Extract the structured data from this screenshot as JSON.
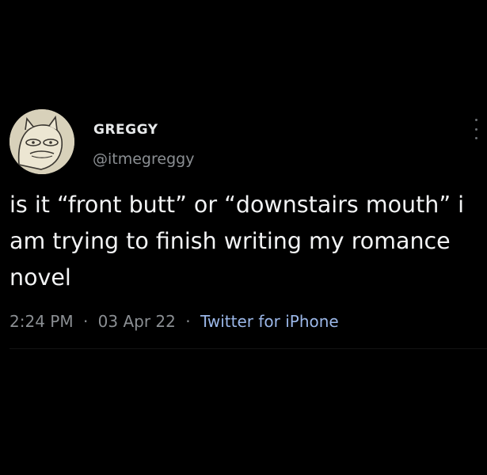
{
  "user": {
    "display_name": "GREGGY",
    "handle": "@itmegreggy",
    "avatar_icon": "cartoon-face-avatar"
  },
  "tweet": {
    "text": "is it “front butt” or “downstairs mouth” i am trying to finish writing my romance novel",
    "time": "2:24 PM",
    "date": "03 Apr 22",
    "source": "Twitter for iPhone",
    "separator": "·"
  },
  "icons": {
    "more": "more-vertical-icon"
  },
  "colors": {
    "background": "#000000",
    "text": "#e7e9ea",
    "secondary": "#8b8f93",
    "link": "#9bb7e8"
  }
}
